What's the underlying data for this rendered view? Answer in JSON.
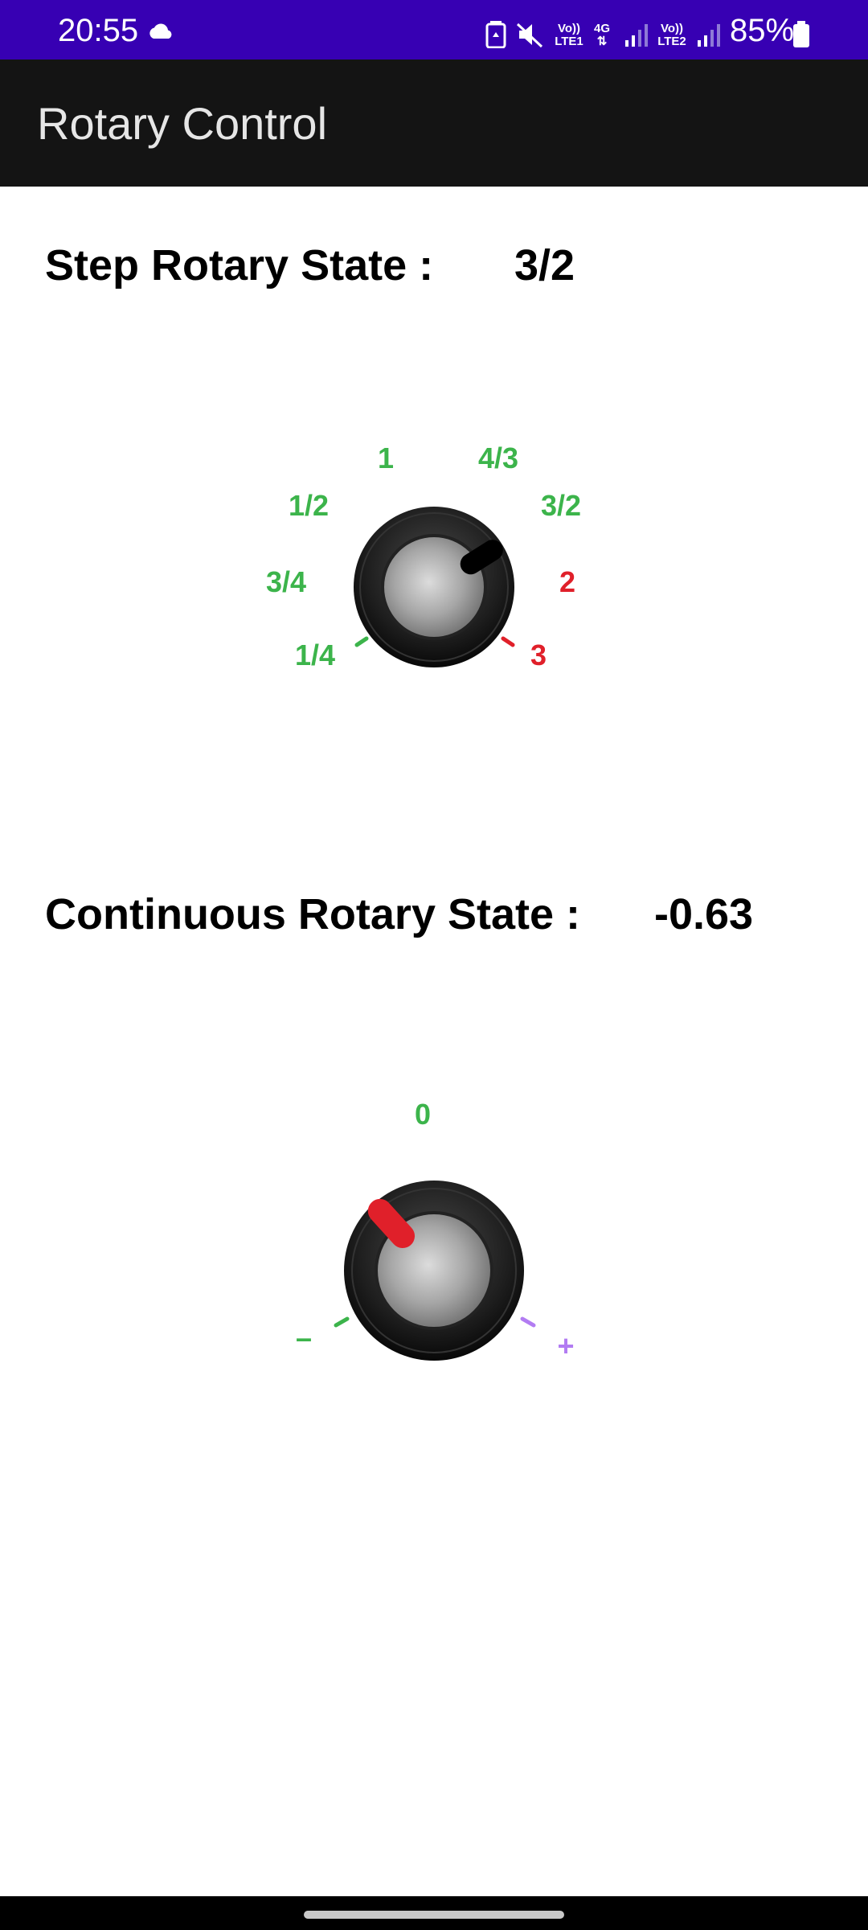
{
  "status_bar": {
    "time": "20:55",
    "battery": "85%",
    "sim1_label_top": "Vo))",
    "sim1_label_bottom": "LTE1",
    "network": "4G",
    "sim2_label_top": "Vo))",
    "sim2_label_bottom": "LTE2",
    "icons": [
      "cloud-icon",
      "battery-saver-icon",
      "mute-icon",
      "signal-icon",
      "battery-icon"
    ],
    "bg_color": "#3700b3"
  },
  "app_bar": {
    "title": "Rotary Control",
    "bg_color": "#141414"
  },
  "step_rotary": {
    "label": "Step Rotary State :",
    "value": "3/2",
    "ticks": [
      {
        "label": "1/4",
        "color": "#3cb44b"
      },
      {
        "label": "3/4",
        "color": "#3cb44b"
      },
      {
        "label": "1/2",
        "color": "#3cb44b"
      },
      {
        "label": "1",
        "color": "#3cb44b"
      },
      {
        "label": "4/3",
        "color": "#3cb44b"
      },
      {
        "label": "3/2",
        "color": "#3cb44b"
      },
      {
        "label": "2",
        "color": "#e0202a"
      },
      {
        "label": "3",
        "color": "#e0202a"
      }
    ],
    "selected_index": 5,
    "indicator_color": "#000000"
  },
  "continuous_rotary": {
    "label": "Continuous Rotary State :",
    "value": "-0.63",
    "min_label": "–",
    "mid_label": "0",
    "max_label": "+",
    "min_color": "#3cb44b",
    "mid_color": "#3cb44b",
    "max_color": "#b27cf2",
    "indicator_color": "#e0202a"
  }
}
